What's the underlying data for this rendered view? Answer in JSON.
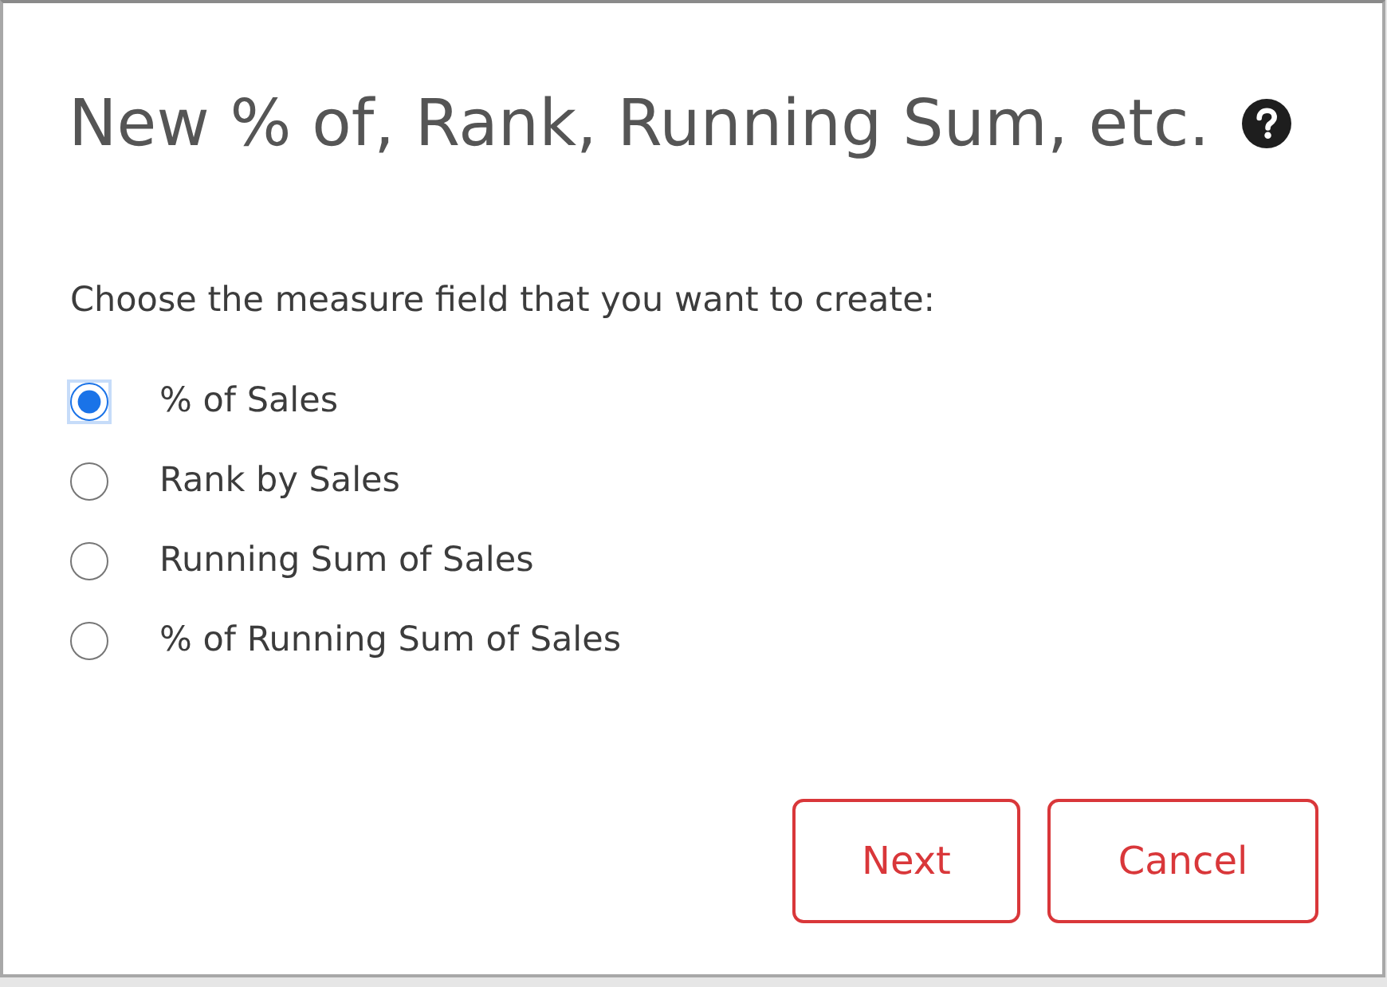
{
  "dialog": {
    "title": "New % of, Rank, Running Sum, etc.",
    "prompt": "Choose the measure field that you want to create:",
    "options": [
      {
        "label": "% of Sales",
        "selected": true
      },
      {
        "label": "Rank by Sales",
        "selected": false
      },
      {
        "label": "Running Sum of Sales",
        "selected": false
      },
      {
        "label": "% of Running Sum of Sales",
        "selected": false
      }
    ],
    "buttons": [
      "Next",
      "Cancel"
    ]
  }
}
